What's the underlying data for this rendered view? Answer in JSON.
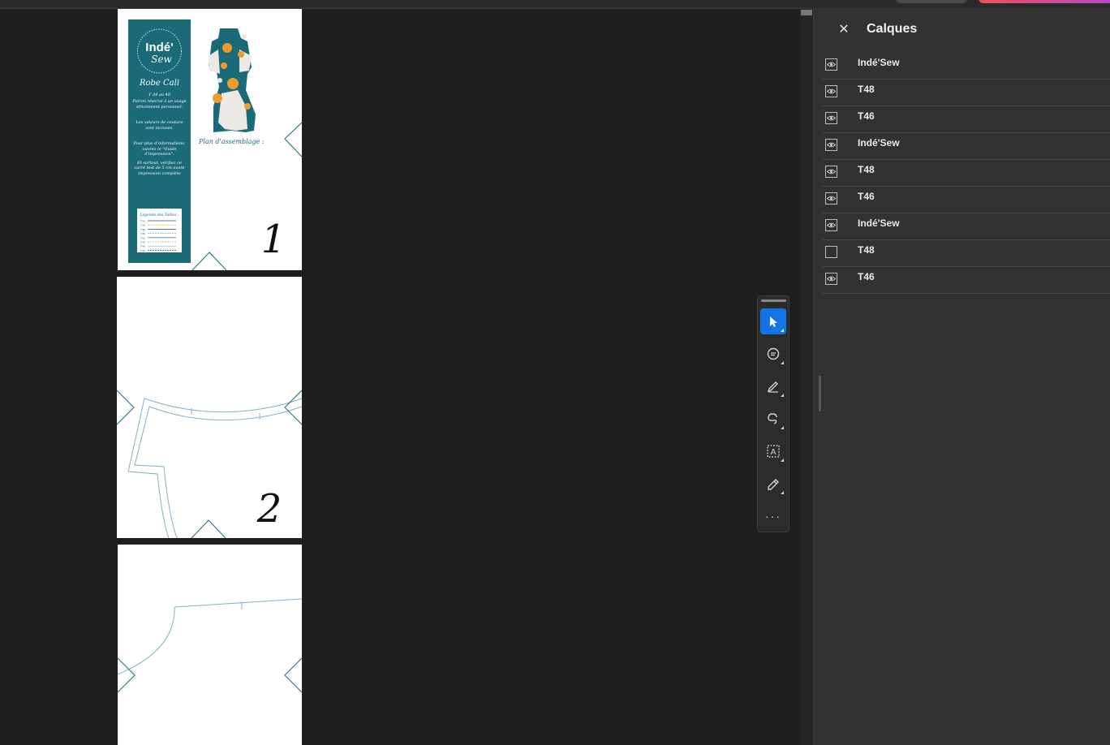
{
  "pages": [
    {
      "sidebar": {
        "brand_top": "Indé'",
        "brand_bottom": "Sew",
        "title": "Robe Cali",
        "sizes": "T 34 au 48",
        "note1": "Patron réservé à un usage strictement personnel.",
        "note2": "Les valeurs de couture sont incluses.",
        "note3": "Pour plus d'informations, ouvrez le \"Guide d'impression\".",
        "note4": "Et surtout, vérifiez ce carré test de 5 cm avant impression complète",
        "legend_title": "Légende des Tailles :",
        "legend_sizes": [
          "T34",
          "T36",
          "T38",
          "T40",
          "T42",
          "T44",
          "T46",
          "T48"
        ],
        "legend_colors": [
          "#1f4d66",
          "#e8a33a",
          "#1f4d66",
          "#7fb0c6",
          "#1f4d66",
          "#e8a33a",
          "#7fb0c6",
          "#1f4d66"
        ]
      },
      "assembly_label": "Plan d'assemblage :",
      "number": "1"
    },
    {
      "number": "2"
    },
    {
      "number": ""
    }
  ],
  "colors": {
    "accent": "#1473e6",
    "pattern_teal": "#1a6a78",
    "pattern_line": "#7fb0c6",
    "dress_orange": "#ef9b2f"
  },
  "tools": [
    {
      "name": "select",
      "icon": "cursor-icon",
      "active": true
    },
    {
      "name": "comment",
      "icon": "comment-icon",
      "active": false
    },
    {
      "name": "highlight",
      "icon": "highlighter-icon",
      "active": false
    },
    {
      "name": "draw",
      "icon": "freeform-draw-icon",
      "active": false
    },
    {
      "name": "text-select",
      "icon": "text-select-icon",
      "active": false
    },
    {
      "name": "sign",
      "icon": "sign-pen-icon",
      "active": false
    },
    {
      "name": "more",
      "icon": "more-icon",
      "active": false
    }
  ],
  "panel": {
    "close_label": "✕",
    "title": "Calques",
    "layers": [
      {
        "name": "Indé'Sew",
        "visible": true
      },
      {
        "name": "T48",
        "visible": true
      },
      {
        "name": "T46",
        "visible": true
      },
      {
        "name": "Indé'Sew",
        "visible": true
      },
      {
        "name": "T48",
        "visible": true
      },
      {
        "name": "T46",
        "visible": true
      },
      {
        "name": "Indé'Sew",
        "visible": true
      },
      {
        "name": "T48",
        "visible": false
      },
      {
        "name": "T46",
        "visible": true
      }
    ]
  }
}
